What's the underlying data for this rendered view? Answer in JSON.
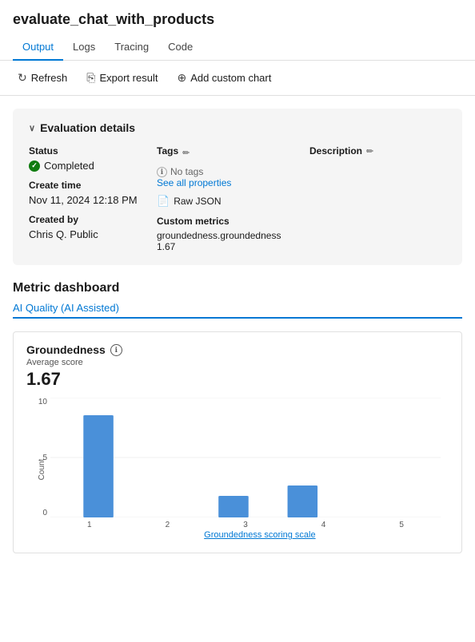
{
  "page": {
    "title": "evaluate_chat_with_products"
  },
  "nav": {
    "tabs": [
      {
        "label": "Output",
        "active": true
      },
      {
        "label": "Logs",
        "active": false
      },
      {
        "label": "Tracing",
        "active": false
      },
      {
        "label": "Code",
        "active": false
      }
    ]
  },
  "toolbar": {
    "refresh_label": "Refresh",
    "export_label": "Export result",
    "add_chart_label": "Add custom chart"
  },
  "eval_card": {
    "header": "Evaluation details",
    "status_label": "Status",
    "status_value": "Completed",
    "create_time_label": "Create time",
    "create_time_value": "Nov 11, 2024 12:18 PM",
    "created_by_label": "Created by",
    "created_by_value": "Chris Q. Public",
    "tags_label": "Tags",
    "no_tags_text": "No tags",
    "see_all_label": "See all properties",
    "raw_json_label": "Raw JSON",
    "custom_metrics_label": "Custom metrics",
    "custom_metrics_key": "groundedness.groundedness",
    "custom_metrics_value": "1.67",
    "description_label": "Description"
  },
  "dashboard": {
    "title": "Metric dashboard",
    "active_tab": "AI Quality (AI Assisted)"
  },
  "chart": {
    "title": "Groundedness",
    "avg_label": "Average score",
    "avg_value": "1.67",
    "y_ticks": [
      "10",
      "5",
      "0"
    ],
    "x_ticks": [
      "1",
      "2",
      "3",
      "4",
      "5"
    ],
    "y_axis_label": "Count",
    "x_axis_label": "Groundedness scoring scale",
    "bars": [
      {
        "x_label": "1",
        "height_pct": 85,
        "count": 9
      },
      {
        "x_label": "2",
        "height_pct": 0,
        "count": 0
      },
      {
        "x_label": "3",
        "height_pct": 15,
        "count": 1.5
      },
      {
        "x_label": "4",
        "height_pct": 22,
        "count": 2
      },
      {
        "x_label": "5",
        "height_pct": 0,
        "count": 0
      }
    ]
  }
}
